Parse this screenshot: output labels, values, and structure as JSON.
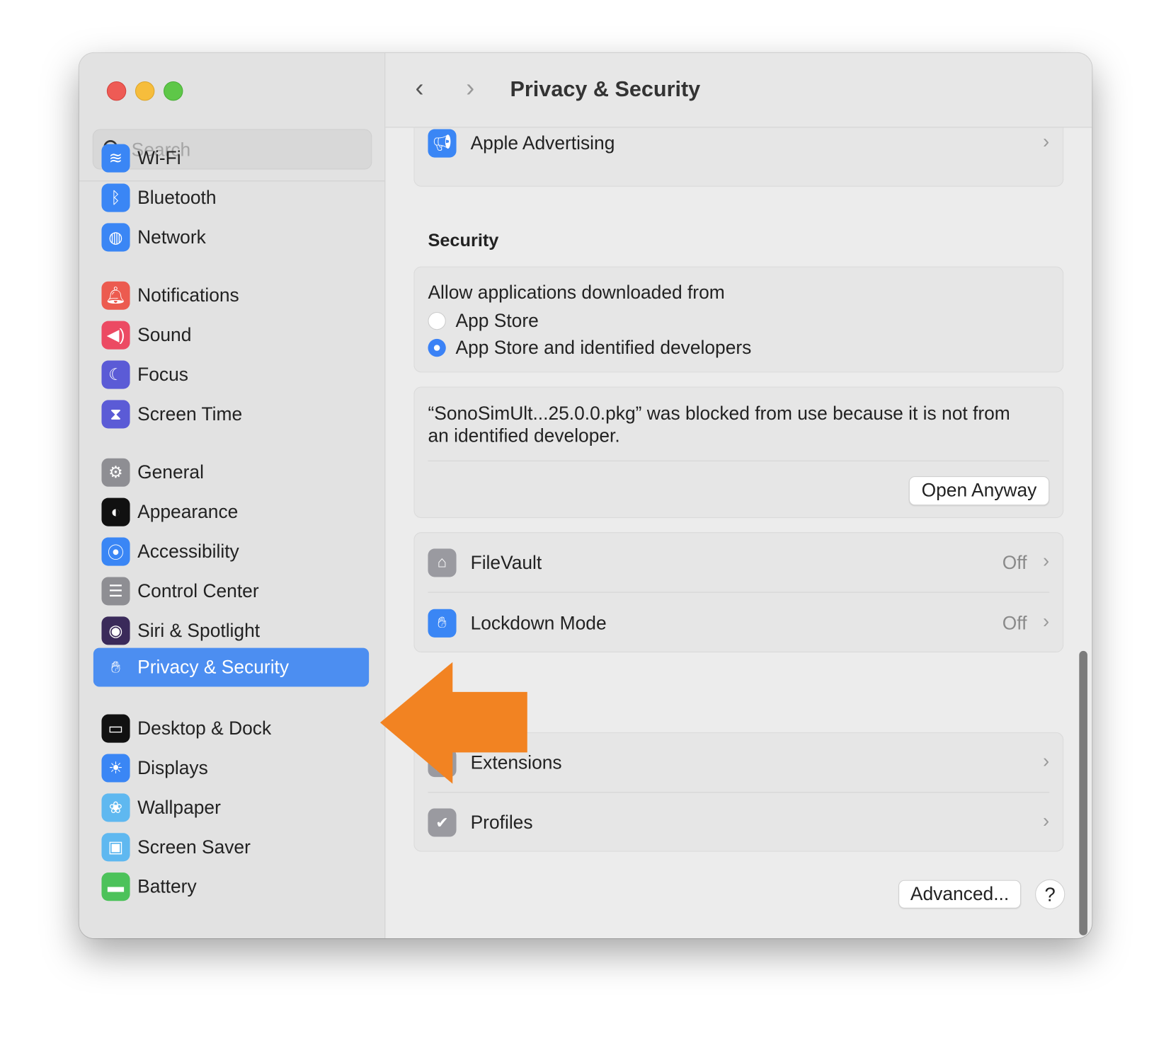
{
  "window": {
    "title": "Privacy & Security"
  },
  "search": {
    "placeholder": "Search"
  },
  "sidebar": {
    "items": [
      {
        "label": "Wi-Fi",
        "icon": "wifi-icon",
        "glyph": "≋",
        "color": "#3a86f5"
      },
      {
        "label": "Bluetooth",
        "icon": "bluetooth-icon",
        "glyph": "ᛒ",
        "color": "#3a86f5"
      },
      {
        "label": "Network",
        "icon": "globe-icon",
        "glyph": "◍",
        "color": "#3a86f5"
      },
      {
        "label": "Notifications",
        "icon": "bell-icon",
        "glyph": "🔔︎",
        "color": "#ec5b4f"
      },
      {
        "label": "Sound",
        "icon": "speaker-icon",
        "glyph": "◀)",
        "color": "#ec4a63"
      },
      {
        "label": "Focus",
        "icon": "moon-icon",
        "glyph": "☾",
        "color": "#5b5bd6"
      },
      {
        "label": "Screen Time",
        "icon": "hourglass-icon",
        "glyph": "⧗",
        "color": "#5b5bd6"
      },
      {
        "label": "General",
        "icon": "gear-icon",
        "glyph": "⚙",
        "color": "#8e8e93"
      },
      {
        "label": "Appearance",
        "icon": "appearance-icon",
        "glyph": "◐",
        "color": "#111111"
      },
      {
        "label": "Accessibility",
        "icon": "accessibility-icon",
        "glyph": "⦿",
        "color": "#3a86f5"
      },
      {
        "label": "Control Center",
        "icon": "toggles-icon",
        "glyph": "☰",
        "color": "#8e8e93"
      },
      {
        "label": "Siri & Spotlight",
        "icon": "siri-icon",
        "glyph": "◉",
        "color": "#3a2a5a"
      },
      {
        "label": "Privacy & Security",
        "icon": "hand-icon",
        "glyph": "✋︎",
        "color": "#3a86f5",
        "selected": true
      },
      {
        "label": "Desktop & Dock",
        "icon": "dock-icon",
        "glyph": "▭",
        "color": "#111111"
      },
      {
        "label": "Displays",
        "icon": "sun-icon",
        "glyph": "☀",
        "color": "#3a86f5"
      },
      {
        "label": "Wallpaper",
        "icon": "flower-icon",
        "glyph": "❀",
        "color": "#5fb8f0"
      },
      {
        "label": "Screen Saver",
        "icon": "screensaver-icon",
        "glyph": "▣",
        "color": "#5fb8f0"
      },
      {
        "label": "Battery",
        "icon": "battery-icon",
        "glyph": "▬",
        "color": "#4cc25a"
      }
    ]
  },
  "main": {
    "apple_advertising": {
      "label": "Apple Advertising"
    },
    "security_heading": "Security",
    "allow": {
      "label": "Allow applications downloaded from",
      "options": [
        "App Store",
        "App Store and identified developers"
      ],
      "selected": "App Store and identified developers"
    },
    "blocked": {
      "line1": "“SonoSimUlt...25.0.0.pkg” was blocked from use because it is not from",
      "line2": "an identified developer.",
      "button": "Open Anyway"
    },
    "filevault": {
      "label": "FileVault",
      "value": "Off"
    },
    "lockdown": {
      "label": "Lockdown Mode",
      "value": "Off"
    },
    "extensions": {
      "label": "Extensions"
    },
    "profiles": {
      "label": "Profiles"
    },
    "advanced_button": "Advanced...",
    "help_button": "?"
  },
  "annotation": {
    "arrow_color": "#f28322"
  }
}
